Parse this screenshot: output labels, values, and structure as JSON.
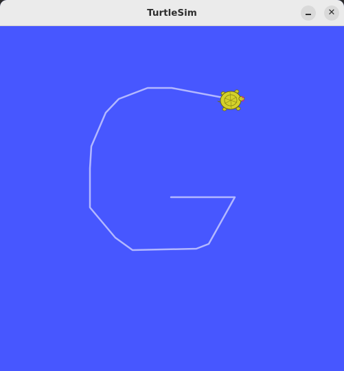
{
  "window": {
    "title": "TurtleSim",
    "minimize_icon": "minimize-icon",
    "close_icon": "close-icon",
    "close_glyph": "✕"
  },
  "canvas": {
    "background_color": "#4757ff",
    "trail_color": "#b3b8ff",
    "turtle_color": "#d4d12b"
  }
}
